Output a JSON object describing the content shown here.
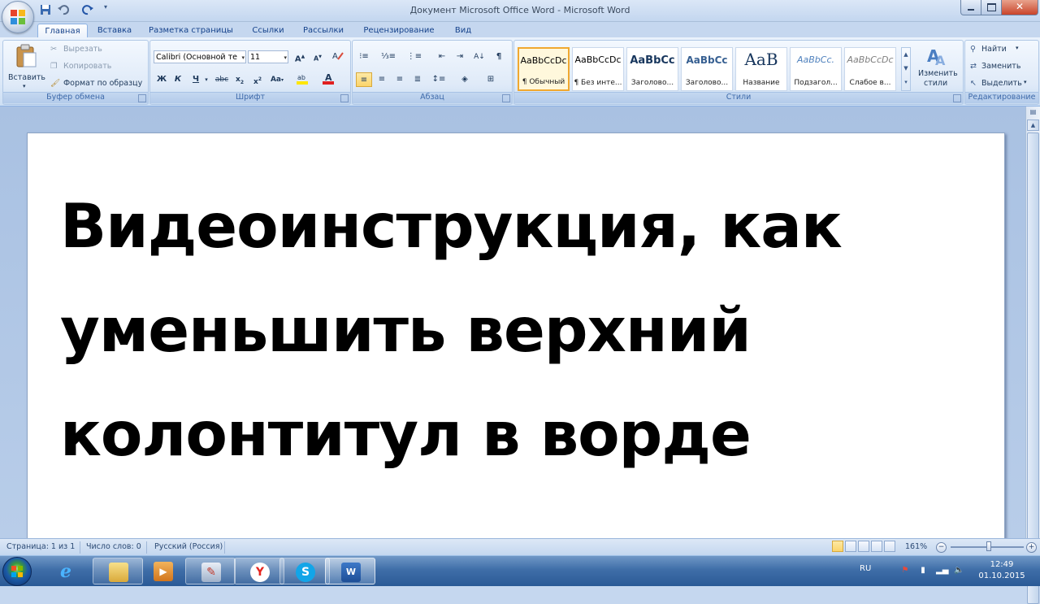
{
  "window": {
    "title": "Документ Microsoft Office Word - Microsoft Word"
  },
  "tabs": [
    "Главная",
    "Вставка",
    "Разметка страницы",
    "Ссылки",
    "Рассылки",
    "Рецензирование",
    "Вид"
  ],
  "ribbon": {
    "clipboard": {
      "paste_label": "Вставить",
      "cut_label": "Вырезать",
      "copy_label": "Копировать",
      "format_painter_label": "Формат по образцу",
      "group_label": "Буфер обмена"
    },
    "font": {
      "font_name": "Calibri (Основной те",
      "font_size": "11",
      "group_label": "Шрифт"
    },
    "paragraph": {
      "group_label": "Абзац"
    },
    "styles": {
      "items": [
        {
          "sample": "AaBbCcDc",
          "name": "¶ Обычный"
        },
        {
          "sample": "AaBbCcDc",
          "name": "¶ Без инте..."
        },
        {
          "sample": "AaBbCc",
          "name": "Заголово..."
        },
        {
          "sample": "AaBbCc",
          "name": "Заголово..."
        },
        {
          "sample": "AaB",
          "name": "Название"
        },
        {
          "sample": "AaBbCc.",
          "name": "Подзагол..."
        },
        {
          "sample": "AaBbCcDc",
          "name": "Слабое в..."
        }
      ],
      "change_styles_line1": "Изменить",
      "change_styles_line2": "стили",
      "group_label": "Стили"
    },
    "editing": {
      "find_label": "Найти",
      "replace_label": "Заменить",
      "select_label": "Выделить",
      "group_label": "Редактирование"
    }
  },
  "document": {
    "lines": [
      "Видеоинструкция, как",
      "уменьшить верхний",
      "колонтитул в ворде"
    ]
  },
  "statusbar": {
    "page": "Страница: 1 из 1",
    "words": "Число слов: 0",
    "language": "Русский (Россия)",
    "zoom": "161%"
  },
  "taskbar": {
    "lang": "RU",
    "time": "12:49",
    "date": "01.10.2015"
  },
  "colors": {
    "ribbon_bg": "#dde9f8",
    "taskbar": "#3f6ea8",
    "accent": "#15428b"
  }
}
